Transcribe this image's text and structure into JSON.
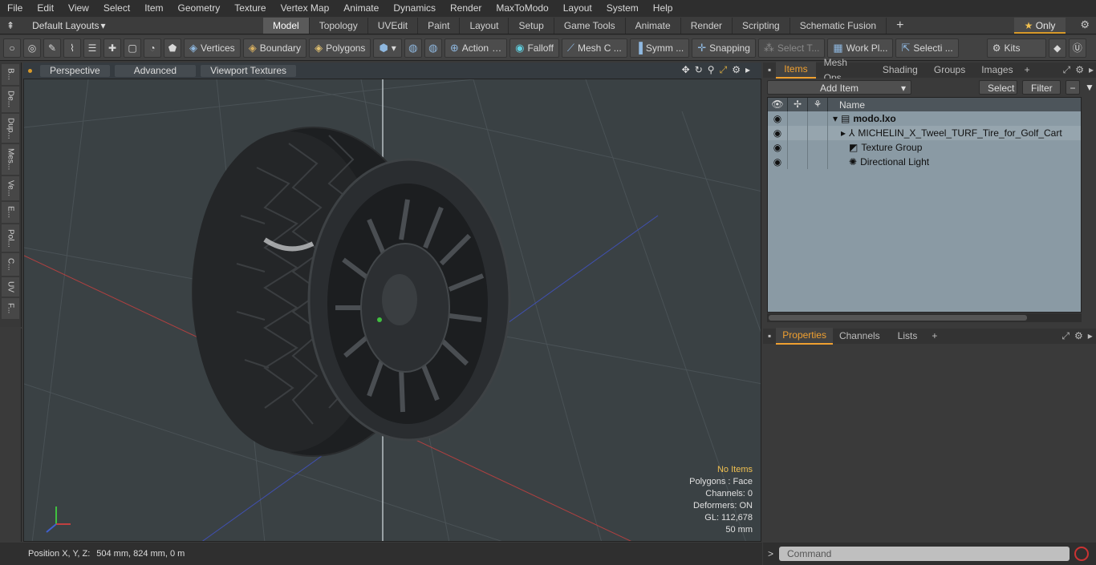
{
  "menu": [
    "File",
    "Edit",
    "View",
    "Select",
    "Item",
    "Geometry",
    "Texture",
    "Vertex Map",
    "Animate",
    "Dynamics",
    "Render",
    "MaxToModo",
    "Layout",
    "System",
    "Help"
  ],
  "layouts_label": "Default Layouts",
  "mode_tabs": [
    "Model",
    "Topology",
    "UVEdit",
    "Paint",
    "Layout",
    "Setup",
    "Game Tools",
    "Animate",
    "Render",
    "Scripting",
    "Schematic Fusion"
  ],
  "mode_tab_plus": "+",
  "only_label": "Only",
  "toolbar": {
    "vertices": "Vertices",
    "boundary": "Boundary",
    "polygons": "Polygons",
    "action": "Action",
    "falloff": "Falloff",
    "mesh": "Mesh C ...",
    "symm": "Symm ...",
    "snapping": "Snapping",
    "select_t": "Select T...",
    "workpl": "Work Pl...",
    "selecti": "Selecti ...",
    "kits": "Kits"
  },
  "left_tabs": [
    "B...",
    "De...",
    "Dup...",
    "Mes...",
    "Ve...",
    "E...",
    "Pol...",
    "C...",
    "UV",
    "F..."
  ],
  "viewport": {
    "perspective": "Perspective",
    "advanced": "Advanced",
    "textures": "Viewport Textures",
    "hud": {
      "no_items": "No Items",
      "polygons": "Polygons : Face",
      "channels": "Channels: 0",
      "deformers": "Deformers: ON",
      "gl": "GL: 112,678",
      "scale": "50 mm"
    }
  },
  "status": {
    "label": "Position X, Y, Z:",
    "value": "504 mm, 824 mm, 0 m"
  },
  "items_tabs": [
    "Items",
    "Mesh Ops",
    "Shading",
    "Groups",
    "Images"
  ],
  "items_tab_plus": "+",
  "items_tools": {
    "add_item": "Add Item",
    "select": "Select",
    "filter": "Filter"
  },
  "tree": {
    "name_header": "Name",
    "rows": [
      {
        "name": "modo.lxo"
      },
      {
        "name": "MICHELIN_X_Tweel_TURF_Tire_for_Golf_Cart"
      },
      {
        "name": "Texture Group"
      },
      {
        "name": "Directional Light"
      }
    ]
  },
  "props_tabs": [
    "Properties",
    "Channels",
    "Lists"
  ],
  "props_tab_plus": "+",
  "command_placeholder": "Command",
  "colors": {
    "accent": "#f0a030",
    "tree_bg": "#8a9aa4",
    "viewport_bg": "#3a4144"
  }
}
